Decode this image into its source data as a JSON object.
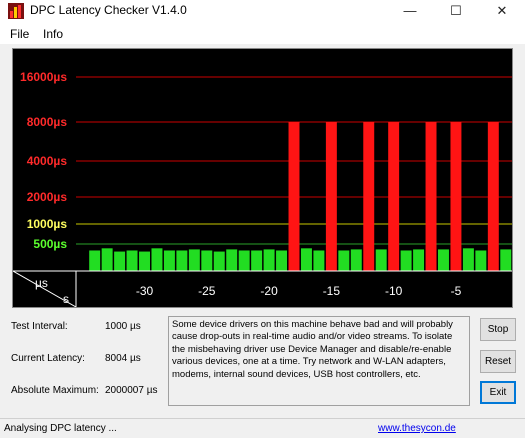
{
  "window": {
    "title": "DPC Latency Checker V1.4.0",
    "minimize_glyph": "—",
    "maximize_glyph": "☐",
    "close_glyph": "✕"
  },
  "menu": {
    "file": "File",
    "info": "Info"
  },
  "colors": {
    "graph_bg": "#000000",
    "red_label": "#ff2a2a",
    "yellow_label": "#ffff60",
    "green_label": "#5cff2e",
    "green_bar": "#22dd22",
    "red_bar": "#ff1414",
    "red_grid": "#cc0000",
    "yellow_grid": "#c8c800",
    "green_grid": "#2aa22a",
    "axis": "#ffffff"
  },
  "chart_data": {
    "type": "bar",
    "y_scale": "log",
    "y_tick_labels": [
      "16000µs",
      "8000µs",
      "4000µs",
      "2000µs",
      "1000µs",
      "500µs"
    ],
    "y_unit_label": "µs",
    "x_unit_label": "s",
    "x_tick_labels": [
      "-30",
      "-25",
      "-20",
      "-15",
      "-10",
      "-5"
    ],
    "thresholds": {
      "green_max_us": 500,
      "yellow_max_us": 1000,
      "red_ticks": [
        2000,
        4000,
        8000,
        16000
      ]
    },
    "bars": [
      {
        "t": -34,
        "us": 380
      },
      {
        "t": -33,
        "us": 420
      },
      {
        "t": -32,
        "us": 360
      },
      {
        "t": -31,
        "us": 380
      },
      {
        "t": -30,
        "us": 360
      },
      {
        "t": -29,
        "us": 420
      },
      {
        "t": -28,
        "us": 380
      },
      {
        "t": -27,
        "us": 380
      },
      {
        "t": -26,
        "us": 400
      },
      {
        "t": -25,
        "us": 380
      },
      {
        "t": -24,
        "us": 360
      },
      {
        "t": -23,
        "us": 400
      },
      {
        "t": -22,
        "us": 380
      },
      {
        "t": -21,
        "us": 380
      },
      {
        "t": -20,
        "us": 400
      },
      {
        "t": -19,
        "us": 380
      },
      {
        "t": -18,
        "us": 8000
      },
      {
        "t": -17,
        "us": 420
      },
      {
        "t": -16,
        "us": 380
      },
      {
        "t": -15,
        "us": 8000
      },
      {
        "t": -14,
        "us": 380
      },
      {
        "t": -13,
        "us": 400
      },
      {
        "t": -12,
        "us": 8000
      },
      {
        "t": -11,
        "us": 400
      },
      {
        "t": -10,
        "us": 8000
      },
      {
        "t": -9,
        "us": 380
      },
      {
        "t": -8,
        "us": 400
      },
      {
        "t": -7,
        "us": 8000
      },
      {
        "t": -6,
        "us": 400
      },
      {
        "t": -5,
        "us": 8000
      },
      {
        "t": -4,
        "us": 420
      },
      {
        "t": -3,
        "us": 380
      },
      {
        "t": -2,
        "us": 8000
      },
      {
        "t": -1,
        "us": 400
      }
    ]
  },
  "stats": {
    "test_interval_label": "Test Interval:",
    "test_interval_value": "1000 µs",
    "current_latency_label": "Current Latency:",
    "current_latency_value": "8004 µs",
    "absolute_maximum_label": "Absolute Maximum:",
    "absolute_maximum_value": "2000007 µs"
  },
  "description": "Some device drivers on this machine behave bad and will probably cause drop-outs in real-time audio and/or video streams. To isolate the misbehaving driver use Device Manager and disable/re-enable various devices, one at a time. Try network and W-LAN adapters, modems, internal sound devices, USB host controllers, etc.",
  "buttons": {
    "stop": "Stop",
    "reset": "Reset",
    "exit": "Exit"
  },
  "status": {
    "text": "Analysing DPC latency ...",
    "link": "www.thesycon.de"
  }
}
